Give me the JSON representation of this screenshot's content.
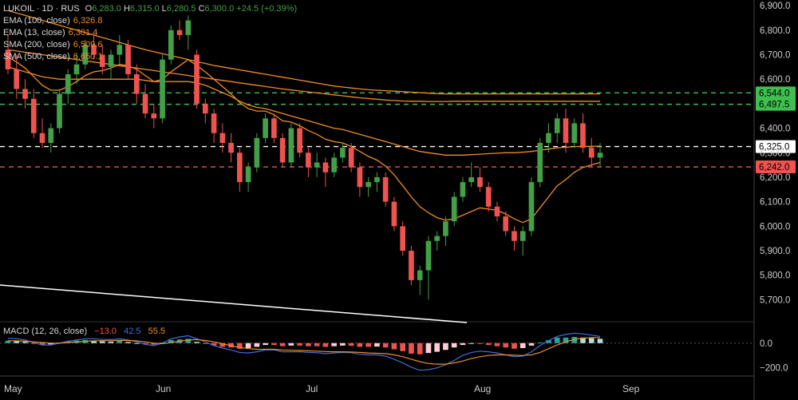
{
  "header": {
    "symbol": "LUKOIL · 1D · RUS",
    "o_label": "O",
    "o": "6,283.0",
    "h_label": "H",
    "h": "6,315.0",
    "l_label": "L",
    "l": "6,280.5",
    "c_label": "C",
    "c": "6,300.0",
    "change": "+24.5 (+0.39%)"
  },
  "indicators": [
    {
      "label": "EMA (100, close)",
      "value": "6,326.8",
      "color": "#f08c2a"
    },
    {
      "label": "EMA (13, close)",
      "value": "6,301.4",
      "color": "#f08c2a"
    },
    {
      "label": "SMA (200, close)",
      "value": "6,509.6",
      "color": "#f08c2a"
    },
    {
      "label": "SMA (500, close)",
      "value": "6,650.1",
      "color": "#f08c2a"
    }
  ],
  "macd": {
    "label": "MACD (12, 26, close)",
    "values": [
      "−13.0",
      "42.5",
      "55.5"
    ],
    "colors": [
      "#ef5350",
      "#3f6fd8",
      "#f08c2a"
    ]
  },
  "colors": {
    "up": "#43a047",
    "down": "#ef5350",
    "ema": "#f08c2a",
    "hline_green": "#3fbf4f",
    "hline_red": "#ef5350",
    "axis_text": "#cfcfcf"
  },
  "chart_data": {
    "type": "candlestick",
    "x_labels": [
      "May",
      "Jun",
      "Jul",
      "Aug",
      "Sep"
    ],
    "y_ticks": [
      "6,900.0",
      "6,800.0",
      "6,700.0",
      "6,600.0",
      "6,400.0",
      "6,300.0",
      "6,200.0",
      "6,100.0",
      "6,000.0",
      "5,900.0",
      "5,800.0",
      "5,700.0"
    ],
    "ylim": [
      5620,
      6910
    ],
    "price_labels": [
      {
        "text": "6,544.0",
        "value": 6544.0,
        "color": "#3fbf4f",
        "line": "dashed"
      },
      {
        "text": "6,497.5",
        "value": 6497.5,
        "color": "#3fbf4f",
        "line": "dashed"
      },
      {
        "text": "6,325.0",
        "value": 6325.0,
        "color": "#ffffff",
        "line": "dashed"
      },
      {
        "text": "6,242.0",
        "value": 6242.0,
        "color": "#ef5350",
        "line": "dashed"
      }
    ],
    "candles": [
      [
        6720,
        6780,
        6620,
        6640
      ],
      [
        6640,
        6700,
        6520,
        6560
      ],
      [
        6560,
        6600,
        6480,
        6520
      ],
      [
        6520,
        6560,
        6360,
        6380
      ],
      [
        6380,
        6440,
        6320,
        6340
      ],
      [
        6340,
        6420,
        6300,
        6400
      ],
      [
        6400,
        6560,
        6380,
        6540
      ],
      [
        6540,
        6640,
        6500,
        6620
      ],
      [
        6620,
        6700,
        6580,
        6660
      ],
      [
        6660,
        6760,
        6640,
        6740
      ],
      [
        6740,
        6780,
        6680,
        6700
      ],
      [
        6700,
        6740,
        6620,
        6650
      ],
      [
        6650,
        6720,
        6600,
        6700
      ],
      [
        6700,
        6780,
        6660,
        6740
      ],
      [
        6740,
        6760,
        6600,
        6620
      ],
      [
        6620,
        6660,
        6500,
        6540
      ],
      [
        6540,
        6580,
        6440,
        6460
      ],
      [
        6460,
        6500,
        6400,
        6440
      ],
      [
        6440,
        6700,
        6420,
        6680
      ],
      [
        6680,
        6820,
        6660,
        6800
      ],
      [
        6800,
        6840,
        6760,
        6780
      ],
      [
        6780,
        6860,
        6720,
        6840
      ],
      [
        6700,
        6720,
        6480,
        6500
      ],
      [
        6500,
        6520,
        6420,
        6460
      ],
      [
        6460,
        6480,
        6340,
        6380
      ],
      [
        6380,
        6420,
        6300,
        6340
      ],
      [
        6340,
        6380,
        6260,
        6300
      ],
      [
        6300,
        6320,
        6140,
        6180
      ],
      [
        6180,
        6260,
        6140,
        6240
      ],
      [
        6240,
        6380,
        6220,
        6360
      ],
      [
        6360,
        6460,
        6340,
        6440
      ],
      [
        6440,
        6460,
        6340,
        6360
      ],
      [
        6360,
        6380,
        6240,
        6260
      ],
      [
        6260,
        6420,
        6240,
        6400
      ],
      [
        6400,
        6420,
        6280,
        6300
      ],
      [
        6300,
        6320,
        6200,
        6240
      ],
      [
        6240,
        6300,
        6200,
        6260
      ],
      [
        6260,
        6280,
        6160,
        6220
      ],
      [
        6220,
        6300,
        6200,
        6280
      ],
      [
        6280,
        6340,
        6260,
        6320
      ],
      [
        6320,
        6340,
        6220,
        6240
      ],
      [
        6240,
        6260,
        6120,
        6160
      ],
      [
        6160,
        6200,
        6120,
        6180
      ],
      [
        6180,
        6220,
        6140,
        6200
      ],
      [
        6200,
        6220,
        6080,
        6100
      ],
      [
        6100,
        6120,
        5980,
        6000
      ],
      [
        6000,
        6020,
        5880,
        5900
      ],
      [
        5900,
        5920,
        5760,
        5780
      ],
      [
        5780,
        5840,
        5720,
        5820
      ],
      [
        5820,
        5960,
        5700,
        5940
      ],
      [
        5940,
        5980,
        5900,
        5960
      ],
      [
        5960,
        6040,
        5920,
        6020
      ],
      [
        6020,
        6140,
        6000,
        6120
      ],
      [
        6120,
        6200,
        6100,
        6180
      ],
      [
        6180,
        6260,
        6160,
        6200
      ],
      [
        6200,
        6240,
        6140,
        6160
      ],
      [
        6160,
        6180,
        6060,
        6080
      ],
      [
        6080,
        6100,
        6020,
        6040
      ],
      [
        6040,
        6060,
        5960,
        5980
      ],
      [
        5980,
        6000,
        5900,
        5940
      ],
      [
        5940,
        6000,
        5880,
        5980
      ],
      [
        5980,
        6200,
        5960,
        6180
      ],
      [
        6180,
        6360,
        6160,
        6340
      ],
      [
        6340,
        6420,
        6300,
        6380
      ],
      [
        6380,
        6460,
        6340,
        6440
      ],
      [
        6440,
        6480,
        6300,
        6340
      ],
      [
        6340,
        6440,
        6320,
        6420
      ],
      [
        6420,
        6460,
        6300,
        6320
      ],
      [
        6320,
        6360,
        6240,
        6280
      ],
      [
        6280,
        6340,
        6240,
        6300
      ]
    ],
    "ema13": [
      6690,
      6670,
      6645,
      6610,
      6575,
      6555,
      6555,
      6570,
      6590,
      6615,
      6630,
      6635,
      6645,
      6660,
      6655,
      6640,
      6615,
      6590,
      6600,
      6630,
      6655,
      6680,
      6655,
      6630,
      6600,
      6570,
      6540,
      6505,
      6480,
      6470,
      6470,
      6455,
      6430,
      6425,
      6410,
      6390,
      6375,
      6355,
      6345,
      6340,
      6325,
      6305,
      6285,
      6270,
      6245,
      6210,
      6165,
      6120,
      6080,
      6055,
      6035,
      6025,
      6030,
      6045,
      6060,
      6075,
      6070,
      6065,
      6050,
      6030,
      6015,
      6030,
      6075,
      6120,
      6165,
      6190,
      6220,
      6240,
      6250,
      6260
    ],
    "ema100": [
      6650,
      6640,
      6630,
      6620,
      6610,
      6605,
      6600,
      6600,
      6600,
      6600,
      6600,
      6600,
      6600,
      6600,
      6600,
      6600,
      6595,
      6590,
      6590,
      6590,
      6590,
      6590,
      6585,
      6575,
      6560,
      6545,
      6530,
      6510,
      6495,
      6485,
      6480,
      6470,
      6460,
      6450,
      6440,
      6430,
      6420,
      6410,
      6400,
      6395,
      6385,
      6375,
      6365,
      6355,
      6345,
      6335,
      6325,
      6315,
      6305,
      6300,
      6295,
      6290,
      6290,
      6290,
      6292,
      6294,
      6296,
      6298,
      6300,
      6300,
      6302,
      6305,
      6310,
      6315,
      6320,
      6322,
      6325,
      6326,
      6326,
      6327
    ],
    "sma200": [
      6720,
      6715,
      6710,
      6705,
      6700,
      6695,
      6690,
      6685,
      6680,
      6675,
      6670,
      6665,
      6660,
      6655,
      6650,
      6645,
      6640,
      6635,
      6630,
      6625,
      6620,
      6615,
      6610,
      6605,
      6600,
      6595,
      6590,
      6585,
      6580,
      6575,
      6570,
      6565,
      6560,
      6556,
      6552,
      6548,
      6544,
      6540,
      6536,
      6532,
      6528,
      6524,
      6521,
      6518,
      6515,
      6513,
      6511,
      6510,
      6510,
      6509,
      6509,
      6509,
      6510,
      6510,
      6510,
      6510,
      6510,
      6510,
      6510,
      6510,
      6510,
      6510,
      6510,
      6510,
      6510,
      6510,
      6510,
      6510,
      6510,
      6510
    ],
    "sma500": [
      6880,
      6870,
      6860,
      6850,
      6840,
      6830,
      6820,
      6810,
      6800,
      6790,
      6780,
      6770,
      6760,
      6750,
      6740,
      6730,
      6720,
      6712,
      6704,
      6696,
      6688,
      6680,
      6672,
      6664,
      6656,
      6650,
      6644,
      6638,
      6632,
      6626,
      6620,
      6614,
      6608,
      6602,
      6596,
      6590,
      6584,
      6578,
      6572,
      6568,
      6564,
      6560,
      6557,
      6555,
      6553,
      6551,
      6549,
      6547,
      6545,
      6543,
      6541,
      6540,
      6540,
      6540,
      6540,
      6540,
      6540,
      6540,
      6540,
      6540,
      6540,
      6540,
      6540,
      6540,
      6540,
      6540,
      6540,
      6540,
      6540,
      6540
    ],
    "macd_ylim": [
      -260,
      160
    ],
    "macd_ticks": [
      "0.0",
      "−200.0"
    ],
    "macd_hist": [
      20,
      18,
      10,
      -5,
      -15,
      -10,
      5,
      15,
      20,
      25,
      20,
      15,
      12,
      18,
      10,
      0,
      -10,
      -12,
      5,
      25,
      30,
      35,
      10,
      -5,
      -20,
      -30,
      -35,
      -45,
      -40,
      -30,
      -15,
      -15,
      -25,
      -20,
      -20,
      -25,
      -25,
      -30,
      -25,
      -20,
      -22,
      -30,
      -30,
      -28,
      -35,
      -50,
      -65,
      -85,
      -90,
      -80,
      -70,
      -55,
      -35,
      -15,
      -5,
      -5,
      -15,
      -25,
      -35,
      -45,
      -40,
      -20,
      5,
      25,
      45,
      45,
      50,
      45,
      40,
      35
    ],
    "macd_line": [
      40,
      35,
      25,
      5,
      -15,
      -15,
      0,
      15,
      25,
      35,
      35,
      30,
      28,
      35,
      25,
      10,
      -10,
      -20,
      0,
      35,
      50,
      60,
      35,
      10,
      -20,
      -40,
      -55,
      -75,
      -80,
      -70,
      -55,
      -55,
      -70,
      -70,
      -70,
      -75,
      -78,
      -85,
      -80,
      -75,
      -78,
      -90,
      -95,
      -95,
      -105,
      -130,
      -160,
      -195,
      -220,
      -215,
      -200,
      -175,
      -140,
      -100,
      -75,
      -65,
      -70,
      -80,
      -95,
      -110,
      -105,
      -70,
      -20,
      20,
      55,
      70,
      80,
      75,
      65,
      55
    ],
    "signal_line": [
      20,
      18,
      15,
      10,
      5,
      0,
      0,
      5,
      10,
      15,
      18,
      20,
      20,
      22,
      22,
      18,
      10,
      0,
      -5,
      5,
      15,
      25,
      28,
      22,
      10,
      -5,
      -20,
      -35,
      -45,
      -50,
      -50,
      -50,
      -55,
      -58,
      -60,
      -62,
      -65,
      -68,
      -70,
      -70,
      -72,
      -75,
      -80,
      -82,
      -85,
      -95,
      -110,
      -130,
      -150,
      -165,
      -170,
      -170,
      -160,
      -145,
      -125,
      -110,
      -100,
      -95,
      -95,
      -98,
      -100,
      -95,
      -75,
      -45,
      -15,
      10,
      30,
      40,
      45,
      45
    ],
    "trendline": [
      [
        0,
        5780
      ],
      [
        56,
        5640
      ]
    ]
  }
}
